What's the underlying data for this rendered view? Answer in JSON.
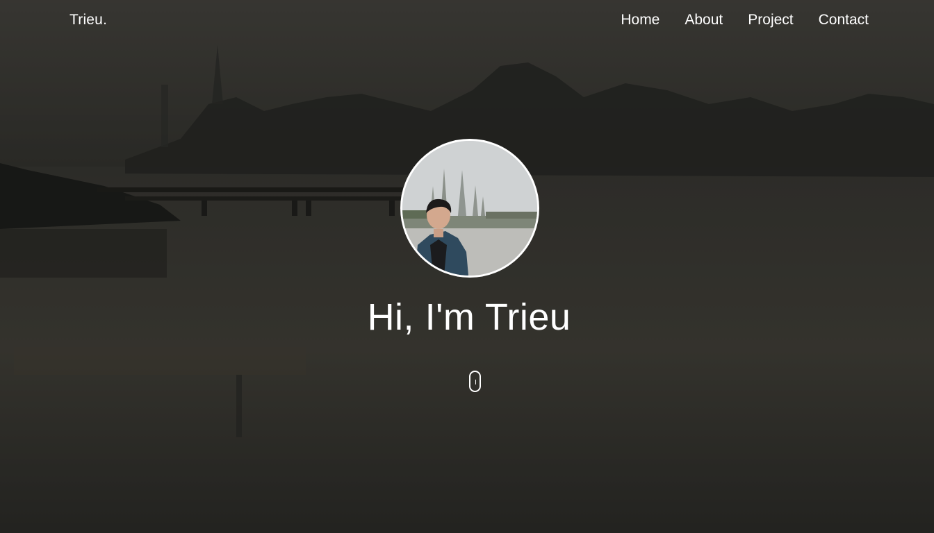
{
  "nav": {
    "brand": "Trieu.",
    "links": [
      {
        "label": "Home"
      },
      {
        "label": "About"
      },
      {
        "label": "Project"
      },
      {
        "label": "Contact"
      }
    ]
  },
  "hero": {
    "greeting": "Hi, I'm Trieu",
    "background_icon": "lake-landscape-photo",
    "avatar_icon": "profile-photo",
    "scroll_icon": "mouse-scroll-icon"
  }
}
